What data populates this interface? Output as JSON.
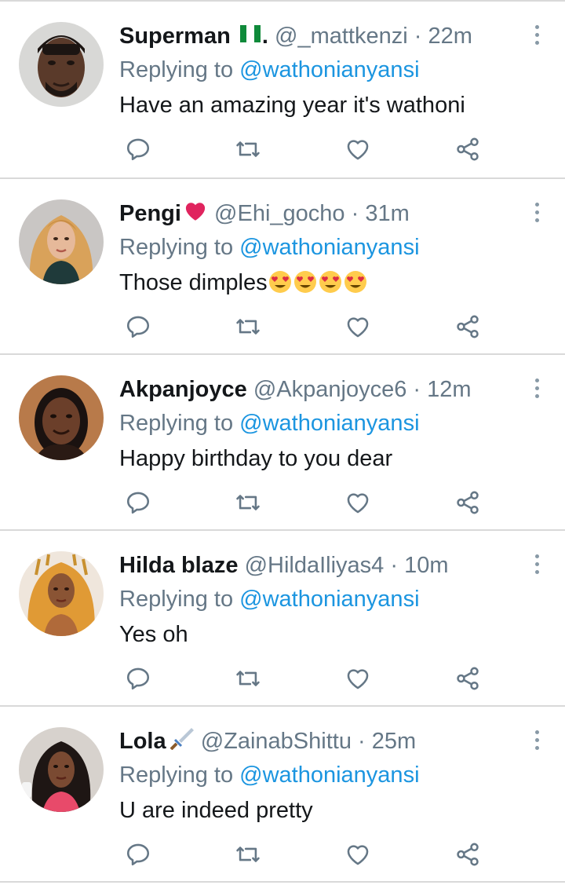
{
  "colors": {
    "text": "#14171a",
    "secondary": "#657786",
    "link": "#1b95e0",
    "divider": "#d9d9d9",
    "icon": "#657786"
  },
  "icons": {
    "reply": "reply-icon",
    "retweet": "retweet-icon",
    "like": "heart-icon",
    "share": "share-icon",
    "more": "more-vertical-icon"
  },
  "tweets": [
    {
      "name": "Superman",
      "name_suffix": ".",
      "name_emoji": "nigeria-flag",
      "handle": "@_mattkenzi",
      "time": "22m",
      "replying_prefix": "Replying to",
      "replying_to": "@wathonianyansi",
      "text": "Have an amazing year it's wathoni"
    },
    {
      "name": "Pengi",
      "name_suffix": "",
      "name_emoji": "red-heart",
      "handle": "@Ehi_gocho",
      "time": "31m",
      "replying_prefix": "Replying to",
      "replying_to": "@wathonianyansi",
      "text": "Those dimples",
      "text_emoji": "heart-eyes x4"
    },
    {
      "name": "Akpanjoyce",
      "name_suffix": "",
      "handle": "@Akpanjoyce6",
      "time": "12m",
      "replying_prefix": "Replying to",
      "replying_to": "@wathonianyansi",
      "text": "Happy birthday to you dear"
    },
    {
      "name": "Hilda blaze",
      "name_suffix": "",
      "handle": "@HildaIliyas4",
      "time": "10m",
      "replying_prefix": "Replying to",
      "replying_to": "@wathonianyansi",
      "text": "Yes oh"
    },
    {
      "name": "Lola",
      "name_suffix": "",
      "name_emoji": "dagger",
      "handle": "@ZainabShittu",
      "time": "25m",
      "replying_prefix": "Replying to",
      "replying_to": "@wathonianyansi",
      "text": "U are indeed pretty"
    }
  ]
}
